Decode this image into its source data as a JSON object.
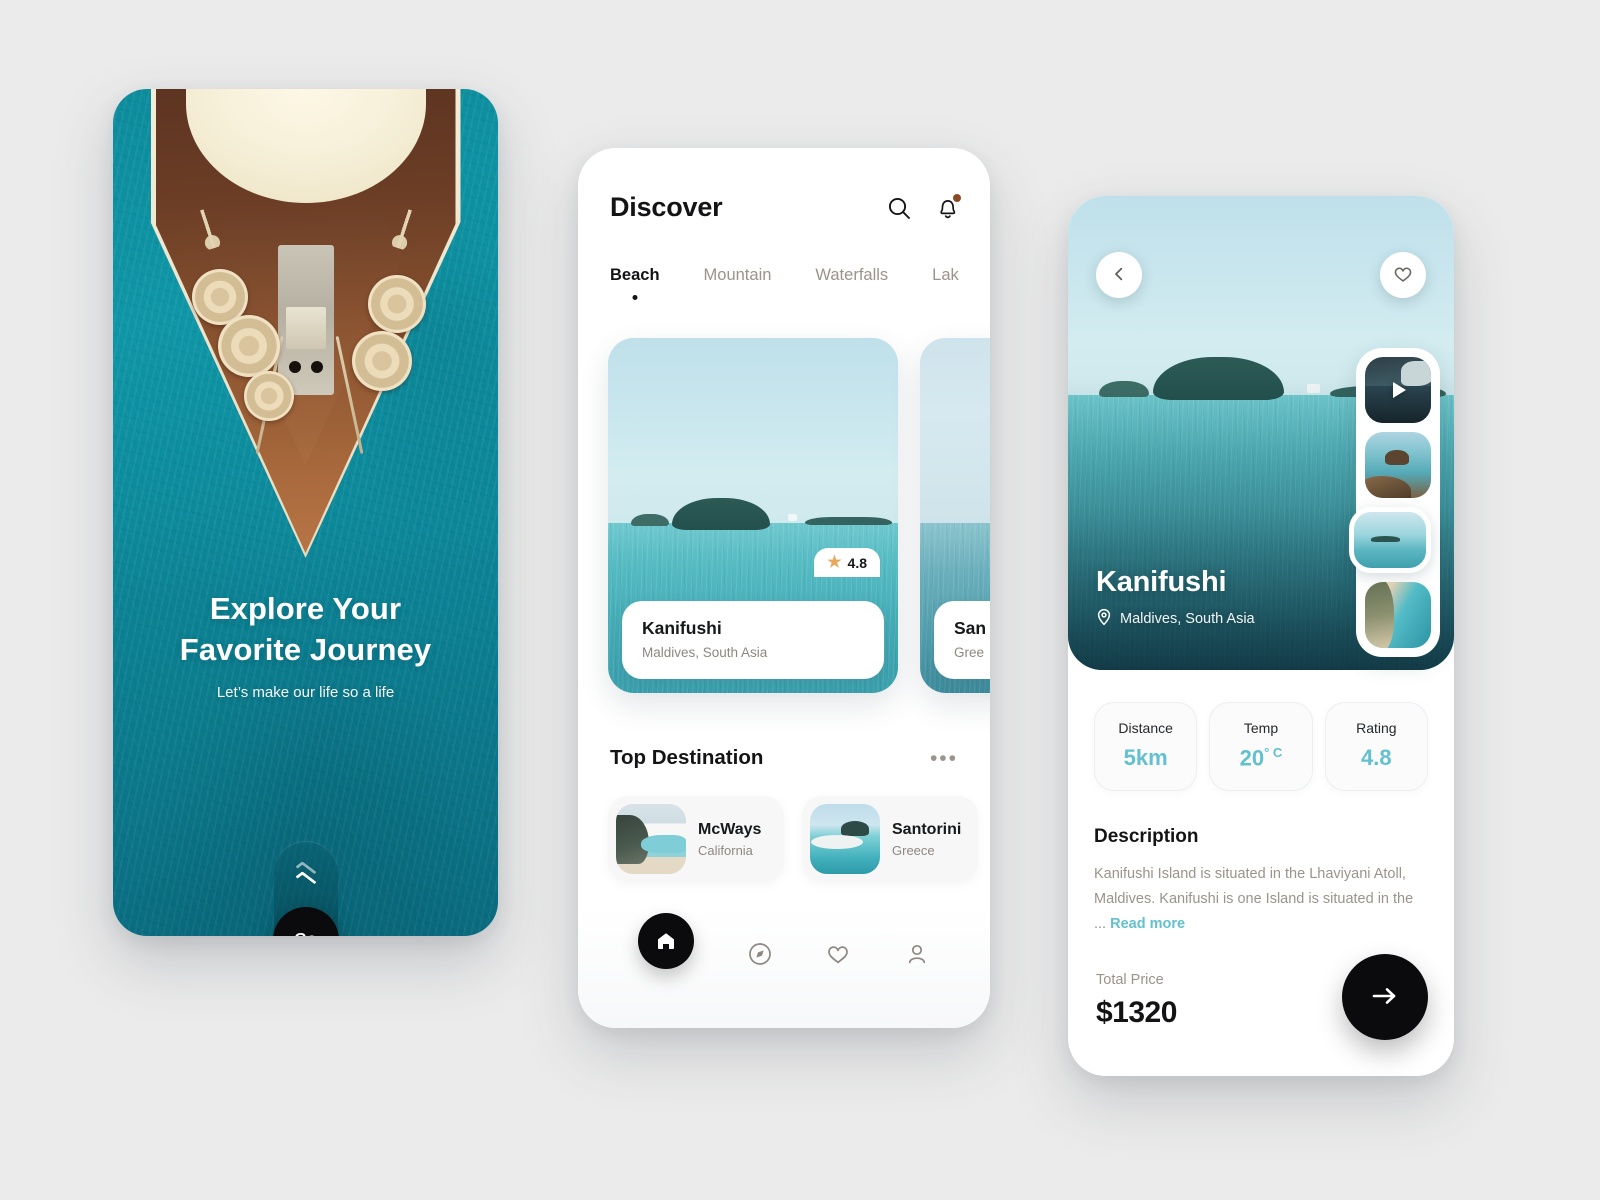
{
  "background_color": "#ebebeb",
  "accent_color": "#62c0cf",
  "onboarding": {
    "title_line1": "Explore Your",
    "title_line2": "Favorite Journey",
    "subtitle": "Let’s make our life so a life",
    "go_label": "Go",
    "scroll_hint_icon": "chevron-up-icon",
    "image_alt": "aerial-boat-on-turquoise-water"
  },
  "discover": {
    "title": "Discover",
    "search_icon": "search-icon",
    "bell_icon": "bell-icon",
    "bell_badge_color": "#8a4a24",
    "tabs": [
      {
        "label": "Beach",
        "active": true
      },
      {
        "label": "Mountain",
        "active": false
      },
      {
        "label": "Waterfalls",
        "active": false
      },
      {
        "label": "Lak",
        "active": false
      }
    ],
    "cards": [
      {
        "name": "Kanifushi",
        "location": "Maldives, South Asia",
        "rating": "4.8",
        "star_icon": "star-icon"
      },
      {
        "name": "San",
        "location": "Gree",
        "rating": "",
        "star_icon": "star-icon"
      }
    ],
    "section": {
      "title": "Top Destination",
      "more_label": "•••"
    },
    "destinations": [
      {
        "name": "McWays",
        "region": "California"
      },
      {
        "name": "Santorini",
        "region": "Greece"
      }
    ],
    "nav": [
      {
        "icon": "home-icon",
        "active": true
      },
      {
        "icon": "compass-icon",
        "active": false
      },
      {
        "icon": "heart-icon",
        "active": false
      },
      {
        "icon": "user-icon",
        "active": false
      }
    ]
  },
  "detail": {
    "back_icon": "chevron-left-icon",
    "favorite_icon": "heart-icon",
    "title": "Kanifushi",
    "location": "Maldives, South Asia",
    "location_icon": "map-pin-icon",
    "thumbnails": [
      {
        "type": "video",
        "play_icon": "play-icon",
        "selected": false
      },
      {
        "type": "image",
        "selected": false
      },
      {
        "type": "image",
        "selected": true
      },
      {
        "type": "image",
        "selected": false
      }
    ],
    "stats": [
      {
        "label": "Distance",
        "value": "5km"
      },
      {
        "label": "Temp",
        "value": "20",
        "unit": "° C"
      },
      {
        "label": "Rating",
        "value": "4.8"
      }
    ],
    "description": {
      "heading": "Description",
      "body": "Kanifushi Island is situated in the Lhaviyani Atoll, Maldives. Kanifushi is one Island is situated in the ...",
      "read_more": "Read more"
    },
    "price": {
      "label": "Total Price",
      "value": "$1320"
    },
    "cta_icon": "arrow-right-icon"
  }
}
